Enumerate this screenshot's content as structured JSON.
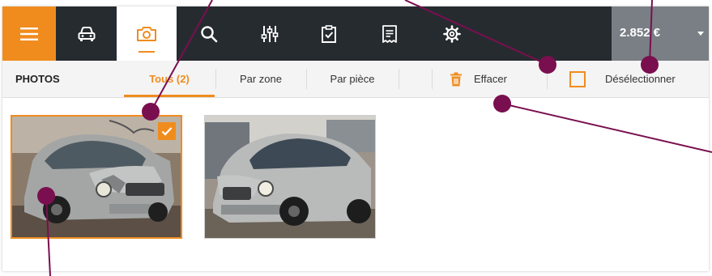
{
  "nav": {
    "items": [
      {
        "icon": "hamburger-menu-icon"
      },
      {
        "icon": "car-icon"
      },
      {
        "icon": "camera-icon",
        "active": true
      },
      {
        "icon": "search-icon"
      },
      {
        "icon": "sliders-icon"
      },
      {
        "icon": "clipboard-check-icon"
      },
      {
        "icon": "receipt-icon"
      },
      {
        "icon": "gear-icon"
      }
    ],
    "total": "2.852 €"
  },
  "toolbar": {
    "section_title": "PHOTOS",
    "tabs": [
      {
        "label": "Tous (2)",
        "active": true
      },
      {
        "label": "Par zone"
      },
      {
        "label": "Par pièce"
      }
    ],
    "clear_label": "Effacer",
    "deselect_label": "Désélectionner"
  },
  "photos": [
    {
      "selected": true
    },
    {
      "selected": false
    }
  ],
  "colors": {
    "accent": "#f08c1e",
    "nav_bg": "#262b30",
    "total_bg": "#7a7f85",
    "annotation": "#7a0f4f"
  }
}
